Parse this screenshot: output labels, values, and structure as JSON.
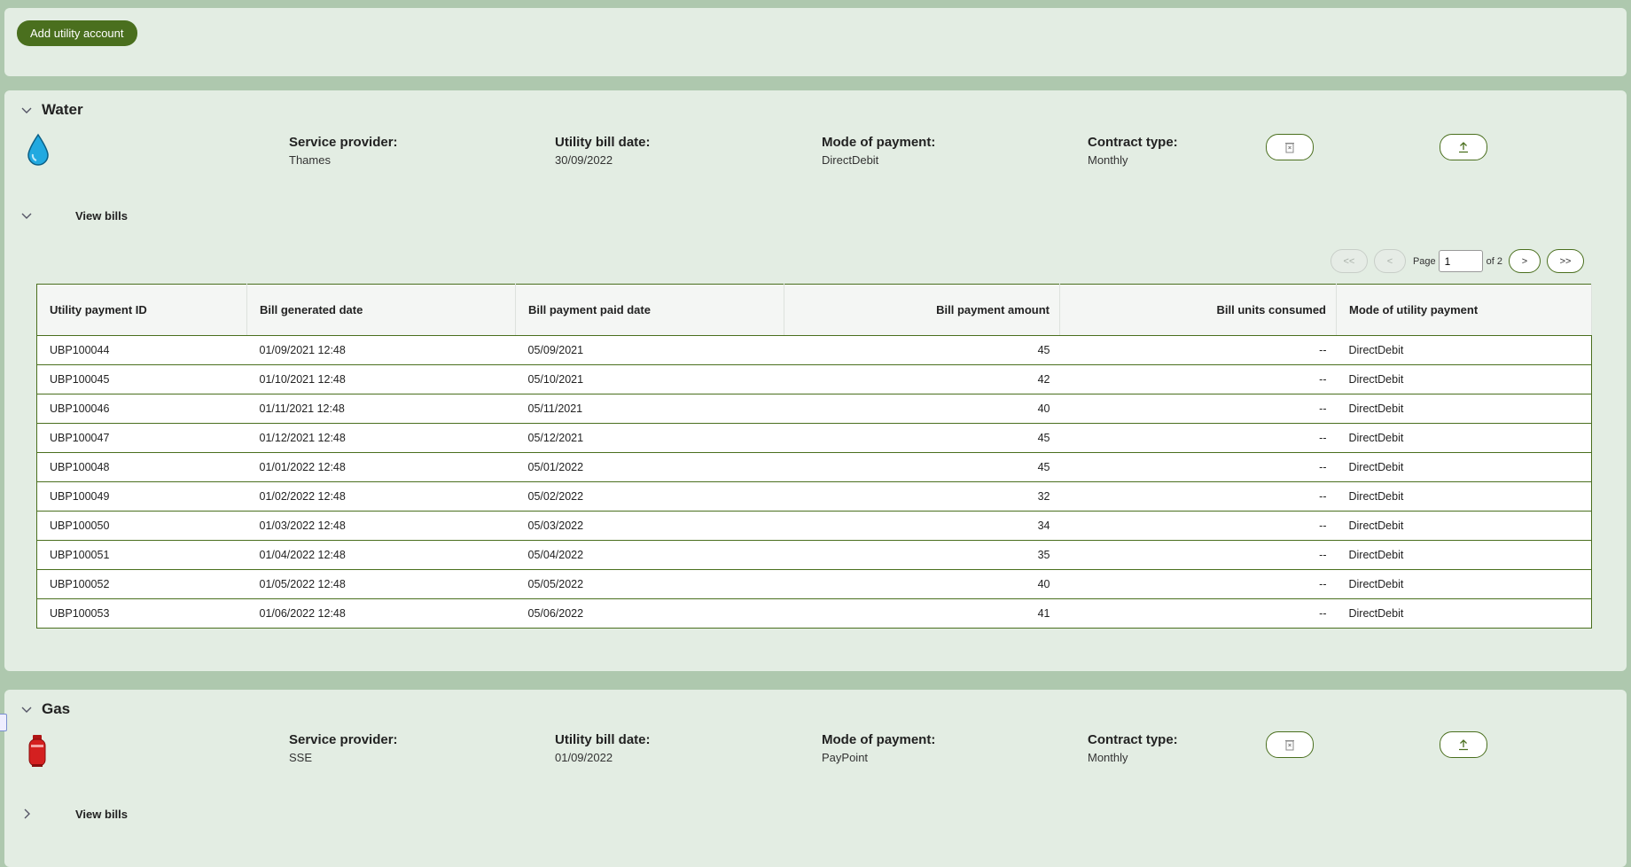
{
  "toolbar": {
    "add_label": "Add utility account"
  },
  "water": {
    "title": "Water",
    "icon": "water-drop-icon",
    "provider_label": "Service provider:",
    "provider": "Thames",
    "bill_date_label": "Utility bill date:",
    "bill_date": "30/09/2022",
    "payment_label": "Mode of payment:",
    "payment": "DirectDebit",
    "contract_label": "Contract type:",
    "contract": "Monthly",
    "view_bills": "View bills",
    "pager": {
      "first": "<<",
      "prev": "<",
      "page_label": "Page",
      "page": "1",
      "of": "of 2",
      "next": ">",
      "last": ">>"
    },
    "table": {
      "headers": [
        "Utility payment ID",
        "Bill generated date",
        "Bill payment paid date",
        "Bill payment amount",
        "Bill units consumed",
        "Mode of utility payment"
      ],
      "rows": [
        [
          "UBP100044",
          "01/09/2021 12:48",
          "05/09/2021",
          "45",
          "--",
          "DirectDebit"
        ],
        [
          "UBP100045",
          "01/10/2021 12:48",
          "05/10/2021",
          "42",
          "--",
          "DirectDebit"
        ],
        [
          "UBP100046",
          "01/11/2021 12:48",
          "05/11/2021",
          "40",
          "--",
          "DirectDebit"
        ],
        [
          "UBP100047",
          "01/12/2021 12:48",
          "05/12/2021",
          "45",
          "--",
          "DirectDebit"
        ],
        [
          "UBP100048",
          "01/01/2022 12:48",
          "05/01/2022",
          "45",
          "--",
          "DirectDebit"
        ],
        [
          "UBP100049",
          "01/02/2022 12:48",
          "05/02/2022",
          "32",
          "--",
          "DirectDebit"
        ],
        [
          "UBP100050",
          "01/03/2022 12:48",
          "05/03/2022",
          "34",
          "--",
          "DirectDebit"
        ],
        [
          "UBP100051",
          "01/04/2022 12:48",
          "05/04/2022",
          "35",
          "--",
          "DirectDebit"
        ],
        [
          "UBP100052",
          "01/05/2022 12:48",
          "05/05/2022",
          "40",
          "--",
          "DirectDebit"
        ],
        [
          "UBP100053",
          "01/06/2022 12:48",
          "05/06/2022",
          "41",
          "--",
          "DirectDebit"
        ]
      ]
    }
  },
  "gas": {
    "title": "Gas",
    "icon": "gas-cylinder-icon",
    "provider_label": "Service provider:",
    "provider": "SSE",
    "bill_date_label": "Utility bill date:",
    "bill_date": "01/09/2022",
    "payment_label": "Mode of payment:",
    "payment": "PayPoint",
    "contract_label": "Contract type:",
    "contract": "Monthly",
    "view_bills": "View bills"
  },
  "colors": {
    "accent": "#4a6f1e",
    "background": "#aec8ae",
    "card": "#e3ede3"
  }
}
